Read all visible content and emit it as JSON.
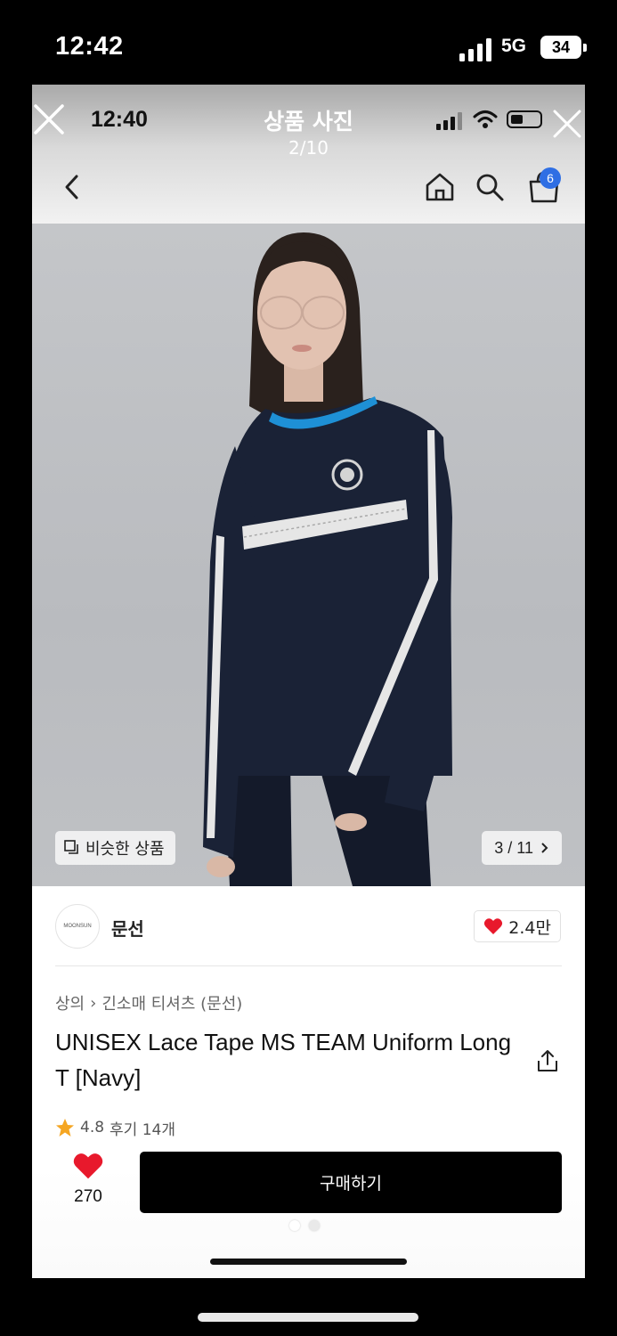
{
  "outer_status": {
    "time": "12:42",
    "network": "5G",
    "battery": "34"
  },
  "viewer": {
    "status_time": "12:40",
    "title": "상품 사진",
    "counter": "2/10"
  },
  "nav": {
    "cart_badge": "6"
  },
  "photo": {
    "similar_label": "비슷한 상품",
    "counter": "3 / 11"
  },
  "brand": {
    "logo_text": "MOONSUN",
    "name": "문선",
    "likes": "2.4만"
  },
  "product": {
    "breadcrumb": [
      "상의",
      "긴소매 티셔츠 (문선)"
    ],
    "title": "UNISEX Lace Tape MS TEAM Uniform Long T [Navy]",
    "rating": "4.8",
    "reviews": "후기 14개"
  },
  "bottom_bar": {
    "wish_count": "270",
    "buy_label": "구매하기"
  },
  "colors": {
    "accent_red": "#e8192c",
    "badge_blue": "#2f6fe4",
    "buy_button": "#000000",
    "sweater_navy": "#1a2236",
    "collar_blue": "#1e90d6"
  }
}
